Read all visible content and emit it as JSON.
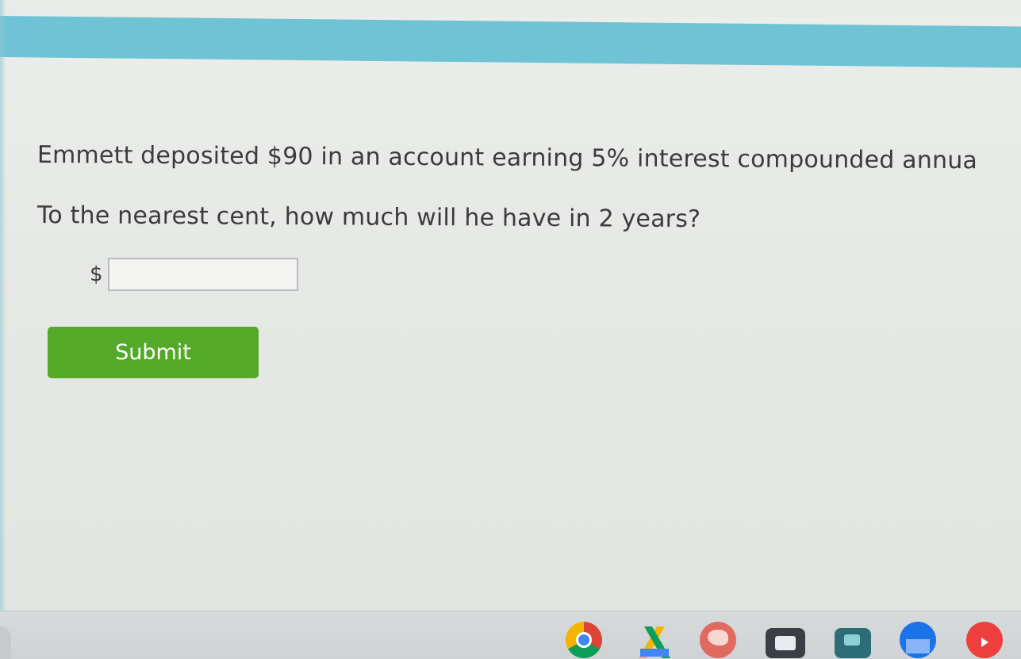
{
  "question": {
    "line1": "Emmett deposited $90 in an account earning 5% interest compounded annua",
    "line2": "To the nearest cent, how much will he have in 2 years?"
  },
  "answer": {
    "currency_symbol": "$",
    "value": "",
    "placeholder": ""
  },
  "submit": {
    "label": "Submit"
  },
  "colors": {
    "header_bar": "#6ec3d4",
    "submit_button": "#55a928",
    "question_text": "#3b3b3b"
  },
  "shelf": {
    "apps": [
      "chrome-icon",
      "drive-icon",
      "paint-icon",
      "docs-icon",
      "screenshot-icon",
      "files-icon",
      "youtube-icon"
    ]
  }
}
